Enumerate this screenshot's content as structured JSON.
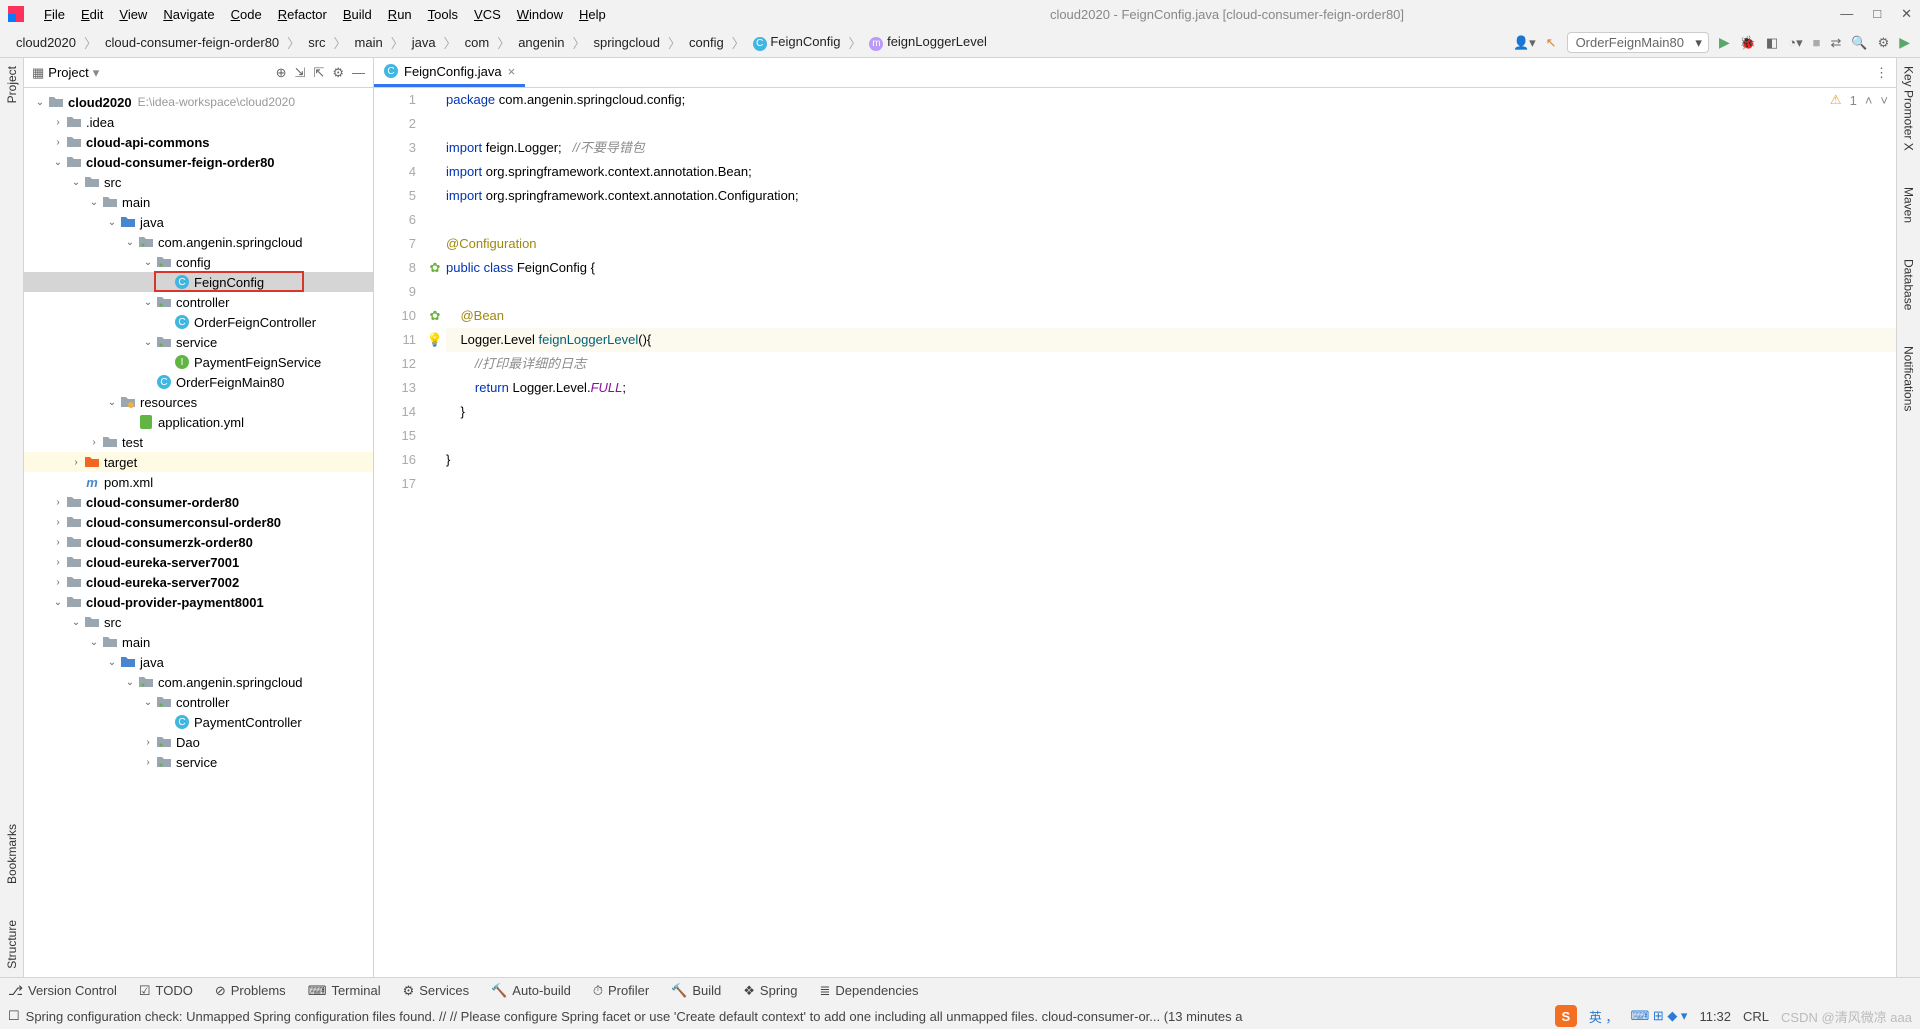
{
  "window": {
    "title": "cloud2020 - FeignConfig.java [cloud-consumer-feign-order80]"
  },
  "menu": [
    "File",
    "Edit",
    "View",
    "Navigate",
    "Code",
    "Refactor",
    "Build",
    "Run",
    "Tools",
    "VCS",
    "Window",
    "Help"
  ],
  "breadcrumbs": [
    "cloud2020",
    "cloud-consumer-feign-order80",
    "src",
    "main",
    "java",
    "com",
    "angenin",
    "springcloud",
    "config",
    "FeignConfig",
    "feignLoggerLevel"
  ],
  "run_config": "OrderFeignMain80",
  "left_gutter": [
    "Project"
  ],
  "left_gutter2": [
    "Bookmarks",
    "Structure"
  ],
  "right_gutter": [
    "Key Promoter X",
    "Maven",
    "Database",
    "Notifications"
  ],
  "panel": {
    "title": "Project",
    "root": "cloud2020",
    "root_path": "E:\\idea-workspace\\cloud2020"
  },
  "tree_items": [
    {
      "depth": 0,
      "arrow": "v",
      "icon": "folder",
      "label": "cloud2020",
      "bold": true,
      "path": "E:\\idea-workspace\\cloud2020"
    },
    {
      "depth": 1,
      "arrow": ">",
      "icon": "folder",
      "label": ".idea"
    },
    {
      "depth": 1,
      "arrow": ">",
      "icon": "folder",
      "label": "cloud-api-commons",
      "bold": true
    },
    {
      "depth": 1,
      "arrow": "v",
      "icon": "folder",
      "label": "cloud-consumer-feign-order80",
      "bold": true
    },
    {
      "depth": 2,
      "arrow": "v",
      "icon": "folder",
      "label": "src"
    },
    {
      "depth": 3,
      "arrow": "v",
      "icon": "folder",
      "label": "main"
    },
    {
      "depth": 4,
      "arrow": "v",
      "icon": "folder-blue",
      "label": "java"
    },
    {
      "depth": 5,
      "arrow": "v",
      "icon": "package",
      "label": "com.angenin.springcloud"
    },
    {
      "depth": 6,
      "arrow": "v",
      "icon": "package",
      "label": "config"
    },
    {
      "depth": 7,
      "arrow": "",
      "icon": "class",
      "label": "FeignConfig",
      "selected": true,
      "redbox": true
    },
    {
      "depth": 6,
      "arrow": "v",
      "icon": "package",
      "label": "controller"
    },
    {
      "depth": 7,
      "arrow": "",
      "icon": "class",
      "label": "OrderFeignController"
    },
    {
      "depth": 6,
      "arrow": "v",
      "icon": "package",
      "label": "service"
    },
    {
      "depth": 7,
      "arrow": "",
      "icon": "interface",
      "label": "PaymentFeignService"
    },
    {
      "depth": 6,
      "arrow": "",
      "icon": "class",
      "label": "OrderFeignMain80"
    },
    {
      "depth": 4,
      "arrow": "v",
      "icon": "folder-res",
      "label": "resources"
    },
    {
      "depth": 5,
      "arrow": "",
      "icon": "yml",
      "label": "application.yml"
    },
    {
      "depth": 3,
      "arrow": ">",
      "icon": "folder",
      "label": "test"
    },
    {
      "depth": 2,
      "arrow": ">",
      "icon": "folder-orange",
      "label": "target",
      "highlighted": true
    },
    {
      "depth": 2,
      "arrow": "",
      "icon": "maven",
      "label": "pom.xml"
    },
    {
      "depth": 1,
      "arrow": ">",
      "icon": "folder",
      "label": "cloud-consumer-order80",
      "bold": true
    },
    {
      "depth": 1,
      "arrow": ">",
      "icon": "folder",
      "label": "cloud-consumerconsul-order80",
      "bold": true
    },
    {
      "depth": 1,
      "arrow": ">",
      "icon": "folder",
      "label": "cloud-consumerzk-order80",
      "bold": true
    },
    {
      "depth": 1,
      "arrow": ">",
      "icon": "folder",
      "label": "cloud-eureka-server7001",
      "bold": true
    },
    {
      "depth": 1,
      "arrow": ">",
      "icon": "folder",
      "label": "cloud-eureka-server7002",
      "bold": true
    },
    {
      "depth": 1,
      "arrow": "v",
      "icon": "folder",
      "label": "cloud-provider-payment8001",
      "bold": true
    },
    {
      "depth": 2,
      "arrow": "v",
      "icon": "folder",
      "label": "src"
    },
    {
      "depth": 3,
      "arrow": "v",
      "icon": "folder",
      "label": "main"
    },
    {
      "depth": 4,
      "arrow": "v",
      "icon": "folder-blue",
      "label": "java"
    },
    {
      "depth": 5,
      "arrow": "v",
      "icon": "package",
      "label": "com.angenin.springcloud"
    },
    {
      "depth": 6,
      "arrow": "v",
      "icon": "package",
      "label": "controller"
    },
    {
      "depth": 7,
      "arrow": "",
      "icon": "class",
      "label": "PaymentController"
    },
    {
      "depth": 6,
      "arrow": ">",
      "icon": "package",
      "label": "Dao"
    },
    {
      "depth": 6,
      "arrow": ">",
      "icon": "package",
      "label": "service"
    }
  ],
  "tab": {
    "name": "FeignConfig.java"
  },
  "code_lines": [
    {
      "n": 1,
      "html": "<span class='kw'>package</span> com.angenin.springcloud.config;"
    },
    {
      "n": 2,
      "html": ""
    },
    {
      "n": 3,
      "html": "<span class='kw'>import</span> feign.Logger;   <span class='cmt'>//不要导错包</span>"
    },
    {
      "n": 4,
      "html": "<span class='kw'>import</span> org.springframework.context.annotation.<span class='cls'>Bean</span>;"
    },
    {
      "n": 5,
      "html": "<span class='kw'>import</span> org.springframework.context.annotation.<span class='cls'>Configuration</span>;"
    },
    {
      "n": 6,
      "html": ""
    },
    {
      "n": 7,
      "html": "<span class='ano'>@Configuration</span>"
    },
    {
      "n": 8,
      "html": "<span class='kw'>public</span> <span class='kw'>class</span> <span class='cls'>FeignConfig</span> {",
      "gicon": "spring"
    },
    {
      "n": 9,
      "html": ""
    },
    {
      "n": 10,
      "html": "    <span class='ano'>@Bean</span>",
      "gicon": "bean"
    },
    {
      "n": 11,
      "html": "    Logger.Level <span class='mtd'>feignLoggerLevel</span>(){",
      "gicon": "bulb",
      "current": true
    },
    {
      "n": 12,
      "html": "        <span class='cmt'>//打印最详细的日志</span>"
    },
    {
      "n": 13,
      "html": "        <span class='kw'>return</span> Logger.Level.<span class='fld2'>FULL</span>;"
    },
    {
      "n": 14,
      "html": "    }"
    },
    {
      "n": 15,
      "html": ""
    },
    {
      "n": 16,
      "html": "}"
    },
    {
      "n": 17,
      "html": ""
    }
  ],
  "editor_status": {
    "warnings": "1"
  },
  "tools": [
    "Version Control",
    "TODO",
    "Problems",
    "Terminal",
    "Services",
    "Auto-build",
    "Profiler",
    "Build",
    "Spring",
    "Dependencies"
  ],
  "status_msg": "Spring configuration check: Unmapped Spring configuration files found. // // Please configure Spring facet or use 'Create default context' to add one including all unmapped files. cloud-consumer-or... (13 minutes a",
  "status_right": {
    "time": "11:32",
    "mode": "CRL",
    "watermark": "CSDN @清风微凉 aaa"
  }
}
